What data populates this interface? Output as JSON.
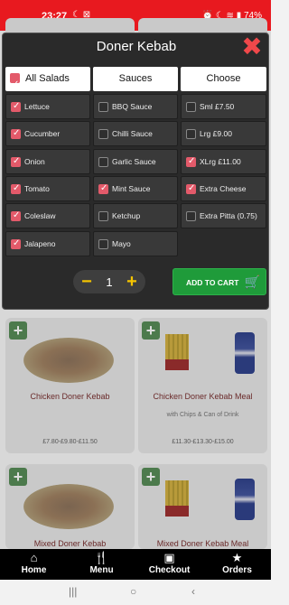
{
  "status": {
    "time": "23:27",
    "icons_left": "☾ ⊠",
    "right": "⏰ ☾ ≋ ▮ 74%"
  },
  "modal": {
    "title": "Doner Kebab",
    "columns": [
      {
        "label": "All Salads",
        "checked": true
      },
      {
        "label": "Sauces"
      },
      {
        "label": "Choose"
      }
    ],
    "salads": [
      {
        "label": "Lettuce",
        "checked": true
      },
      {
        "label": "Cucumber",
        "checked": true
      },
      {
        "label": "Onion",
        "checked": true
      },
      {
        "label": "Tomato",
        "checked": true
      },
      {
        "label": "Coleslaw",
        "checked": true
      },
      {
        "label": "Jalapeno",
        "checked": true
      }
    ],
    "sauces": [
      {
        "label": "BBQ Sauce",
        "checked": false
      },
      {
        "label": "Chilli Sauce",
        "checked": false
      },
      {
        "label": "Garlic Sauce",
        "checked": false
      },
      {
        "label": "Mint Sauce",
        "checked": true
      },
      {
        "label": "Ketchup",
        "checked": false
      },
      {
        "label": "Mayo",
        "checked": false
      }
    ],
    "choose": [
      {
        "label": "Sml £7.50",
        "checked": false
      },
      {
        "label": "Lrg £9.00",
        "checked": false
      },
      {
        "label": "XLrg £11.00",
        "checked": true
      },
      {
        "label": "Extra Cheese",
        "checked": true
      },
      {
        "label": "Extra Pitta (0.75)",
        "checked": false
      }
    ],
    "quantity": {
      "minus": "−",
      "value": "1",
      "plus": "+"
    },
    "add_to_cart": "ADD TO CART"
  },
  "cards": [
    {
      "title": "Chicken Doner Kebab",
      "sub": "",
      "price": "£7.80-£9.80-£11.50"
    },
    {
      "title": "Chicken Doner Kebab Meal",
      "sub": "with Chips & Can of Drink",
      "price": "£11.30-£13.30-£15.00"
    },
    {
      "title": "Mixed Doner Kebab",
      "sub": "",
      "price": ""
    },
    {
      "title": "Mixed Doner Kebab Meal",
      "sub": "",
      "price": ""
    }
  ],
  "nav": [
    {
      "label": "Home",
      "icon": "home-icon"
    },
    {
      "label": "Menu",
      "icon": "utensils-icon"
    },
    {
      "label": "Checkout",
      "icon": "bag-icon"
    },
    {
      "label": "Orders",
      "icon": "star-icon"
    }
  ],
  "colors": {
    "status_bar": "#e8191f",
    "checkbox_on": "#e35a6a",
    "add_cart": "#1f9b3a",
    "qty_accent": "#f5c400",
    "close": "#f0484a"
  }
}
